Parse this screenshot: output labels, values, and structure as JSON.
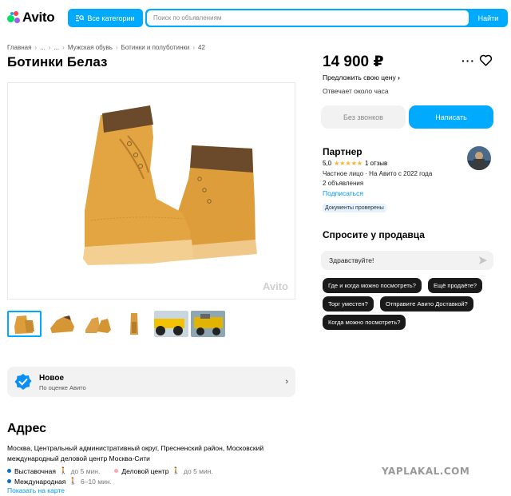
{
  "header": {
    "logo_text": "Avito",
    "logo_colors": [
      "#04e061",
      "#ff4053",
      "#965eeb",
      "#0af"
    ],
    "categories_label": "Все категории",
    "search_placeholder": "Поиск по объявлениям",
    "search_button": "Найти"
  },
  "breadcrumb": [
    "Главная",
    "...",
    "...",
    "Мужская обувь",
    "Ботинки и полуботинки",
    "42"
  ],
  "listing": {
    "title": "Ботинки Белаз",
    "image_watermark": "Avito",
    "thumbnails": [
      "boots-front",
      "boots-side",
      "boots-pair",
      "boots-sole",
      "belaz-truck",
      "belaz-truck-2"
    ]
  },
  "condition": {
    "title": "Новое",
    "subtitle": "По оценке Авито"
  },
  "address": {
    "heading": "Адрес",
    "text": "Москва, Центральный административный округ, Пресненский район, Московский международный деловой центр Москва-Сити",
    "metro": [
      {
        "name": "Выставочная",
        "time": "до 5 мин.",
        "color": "#0a6fc2"
      },
      {
        "name": "Деловой центр",
        "time": "до 5 мин.",
        "color": "#ffa8af"
      },
      {
        "name": "Международная",
        "time": "6–10 мин.",
        "color": "#0a6fc2"
      }
    ],
    "map_link": "Показать на карте"
  },
  "sidebar": {
    "price": "14 900 ₽",
    "offer_price": "Предложить свою цену",
    "reply_time": "Отвечает около часа",
    "no_calls": "Без звонков",
    "write": "Написать",
    "seller": {
      "name": "Партнер",
      "rating": "5,0",
      "stars": "★★★★★",
      "reviews": "1 отзыв",
      "info": "Частное лицо · На Авито с 2022 года",
      "ads": "2 объявления",
      "subscribe": "Подписаться",
      "verified": "Документы проверены"
    },
    "ask": {
      "heading": "Спросите у продавца",
      "input_value": "Здравствуйте!",
      "chips": [
        "Где и когда можно посмотреть?",
        "Ещё продаёте?",
        "Торг уместен?",
        "Отправите Авито Доставкой?",
        "Когда можно посмотреть?"
      ]
    }
  },
  "watermark_site": "YAPLAKAL.COM"
}
